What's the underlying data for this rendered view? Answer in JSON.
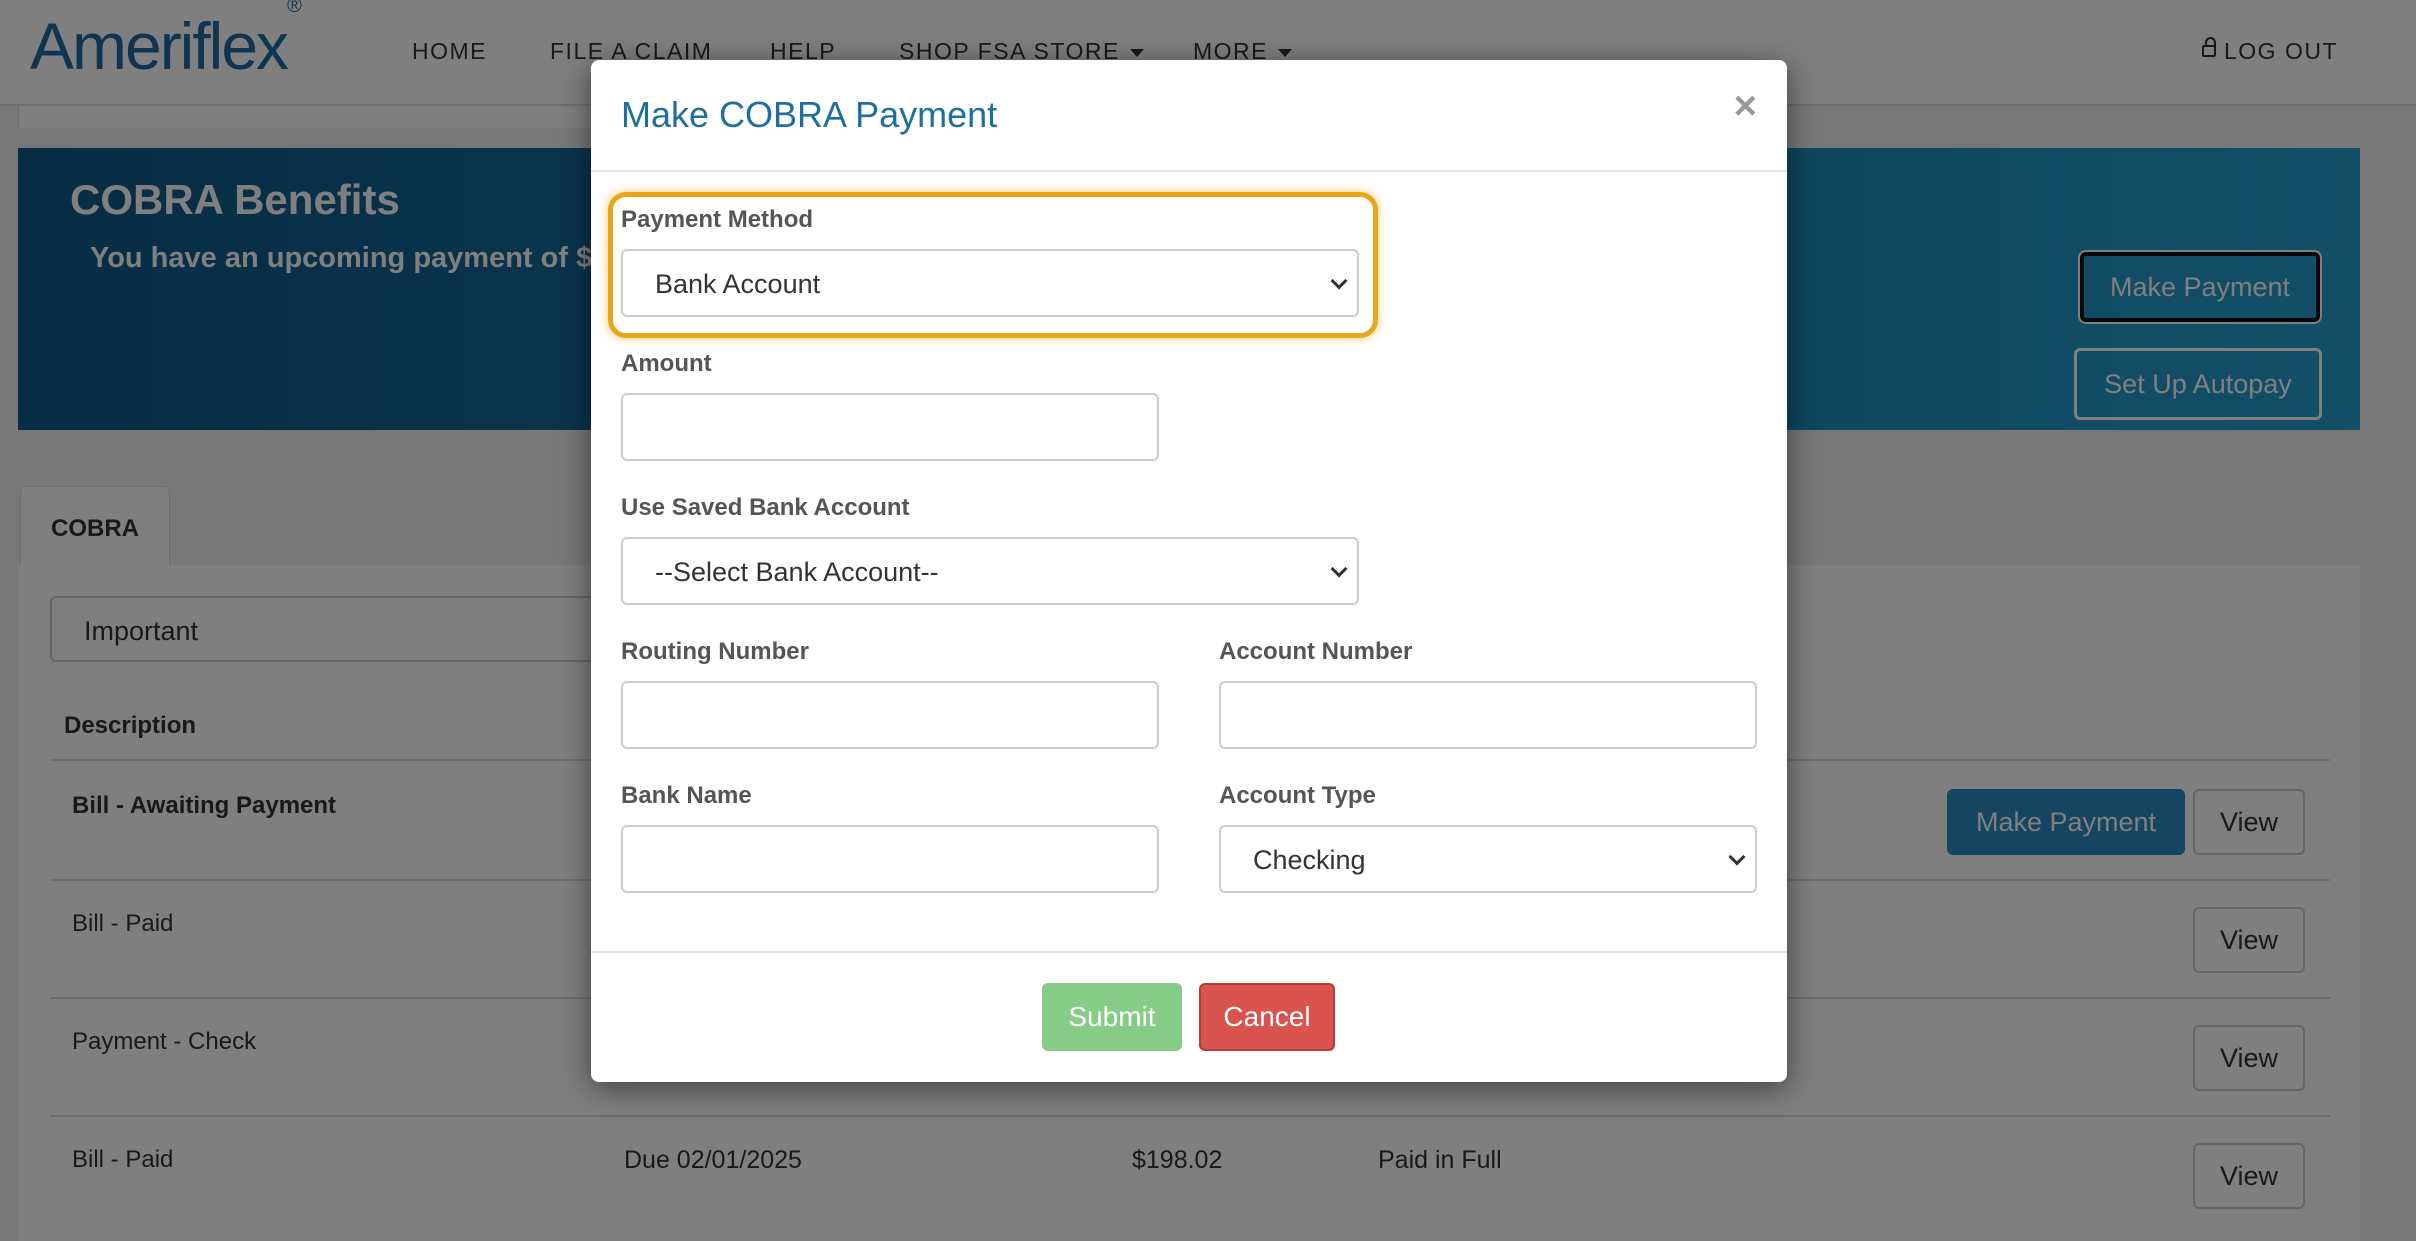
{
  "navbar": {
    "logo_text": "Ameriflex",
    "logo_mark": "®",
    "items": [
      {
        "label": "HOME"
      },
      {
        "label": "FILE A CLAIM"
      },
      {
        "label": "HELP"
      },
      {
        "label": "SHOP FSA STORE"
      },
      {
        "label": "MORE"
      }
    ],
    "logout_label": "LOG OUT"
  },
  "banner": {
    "title": "COBRA Benefits",
    "subtitle": "You have an upcoming payment of $",
    "make_payment_label": "Make Payment",
    "autopay_label": "Set Up Autopay"
  },
  "content": {
    "tab_label": "COBRA",
    "filter_value": "Important",
    "column_description": "Description",
    "rows": [
      {
        "description": "Bill - Awaiting Payment",
        "due": "",
        "amount": "",
        "status": "",
        "pay_label": "Make Payment",
        "view_label": "View"
      },
      {
        "description": "Bill - Paid",
        "due": "",
        "amount": "",
        "status": "",
        "view_label": "View"
      },
      {
        "description": "Payment - Check",
        "due": "",
        "amount": "",
        "status": "",
        "view_label": "View"
      },
      {
        "description": "Bill - Paid",
        "due": "Due 02/01/2025",
        "amount": "$198.02",
        "status": "Paid in Full",
        "view_label": "View"
      }
    ]
  },
  "modal": {
    "title": "Make COBRA Payment",
    "close_symbol": "×",
    "payment_method": {
      "label": "Payment Method",
      "value": "Bank Account"
    },
    "amount": {
      "label": "Amount",
      "value": ""
    },
    "saved_bank": {
      "label": "Use Saved Bank Account",
      "value": "--Select Bank Account--"
    },
    "routing": {
      "label": "Routing Number",
      "value": ""
    },
    "account_number": {
      "label": "Account Number",
      "value": ""
    },
    "bank_name": {
      "label": "Bank Name",
      "value": ""
    },
    "account_type": {
      "label": "Account Type",
      "value": "Checking"
    },
    "submit_label": "Submit",
    "cancel_label": "Cancel"
  },
  "colors": {
    "brand": "#1d6aa5",
    "highlight": "#e8a71a",
    "submit": "#86cc86",
    "cancel": "#d9534f",
    "primary": "#2b8bc0"
  }
}
